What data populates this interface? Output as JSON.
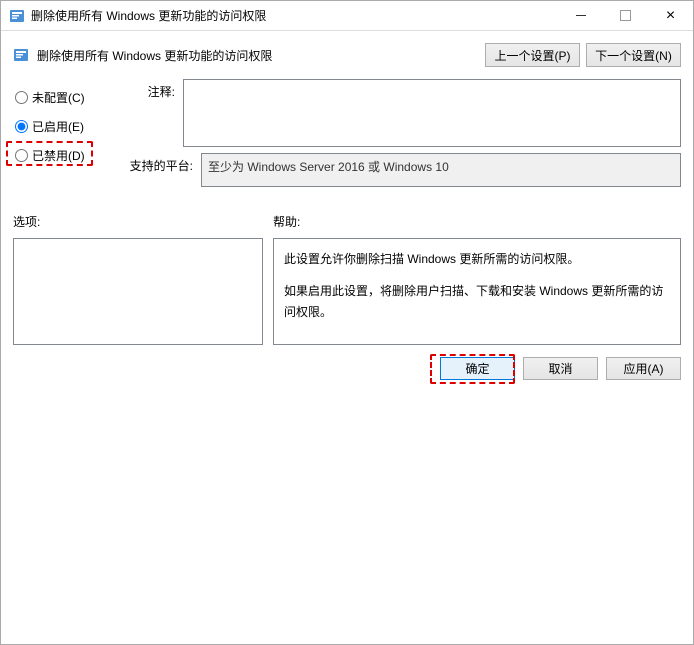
{
  "window": {
    "title": "删除使用所有 Windows 更新功能的访问权限"
  },
  "toolbar": {
    "title": "删除使用所有 Windows 更新功能的访问权限",
    "prev_setting": "上一个设置(P)",
    "next_setting": "下一个设置(N)"
  },
  "radios": {
    "not_configured": "未配置(C)",
    "enabled": "已启用(E)",
    "disabled": "已禁用(D)"
  },
  "fields": {
    "comment_label": "注释:",
    "comment_value": "",
    "platform_label": "支持的平台:",
    "platform_value": "至少为 Windows Server 2016 或 Windows 10"
  },
  "lower": {
    "options_label": "选项:",
    "help_label": "帮助:",
    "help_p1": "此设置允许你删除扫描 Windows 更新所需的访问权限。",
    "help_p2": "如果启用此设置，将删除用户扫描、下载和安装 Windows 更新所需的访问权限。"
  },
  "buttons": {
    "ok": "确定",
    "cancel": "取消",
    "apply": "应用(A)"
  }
}
